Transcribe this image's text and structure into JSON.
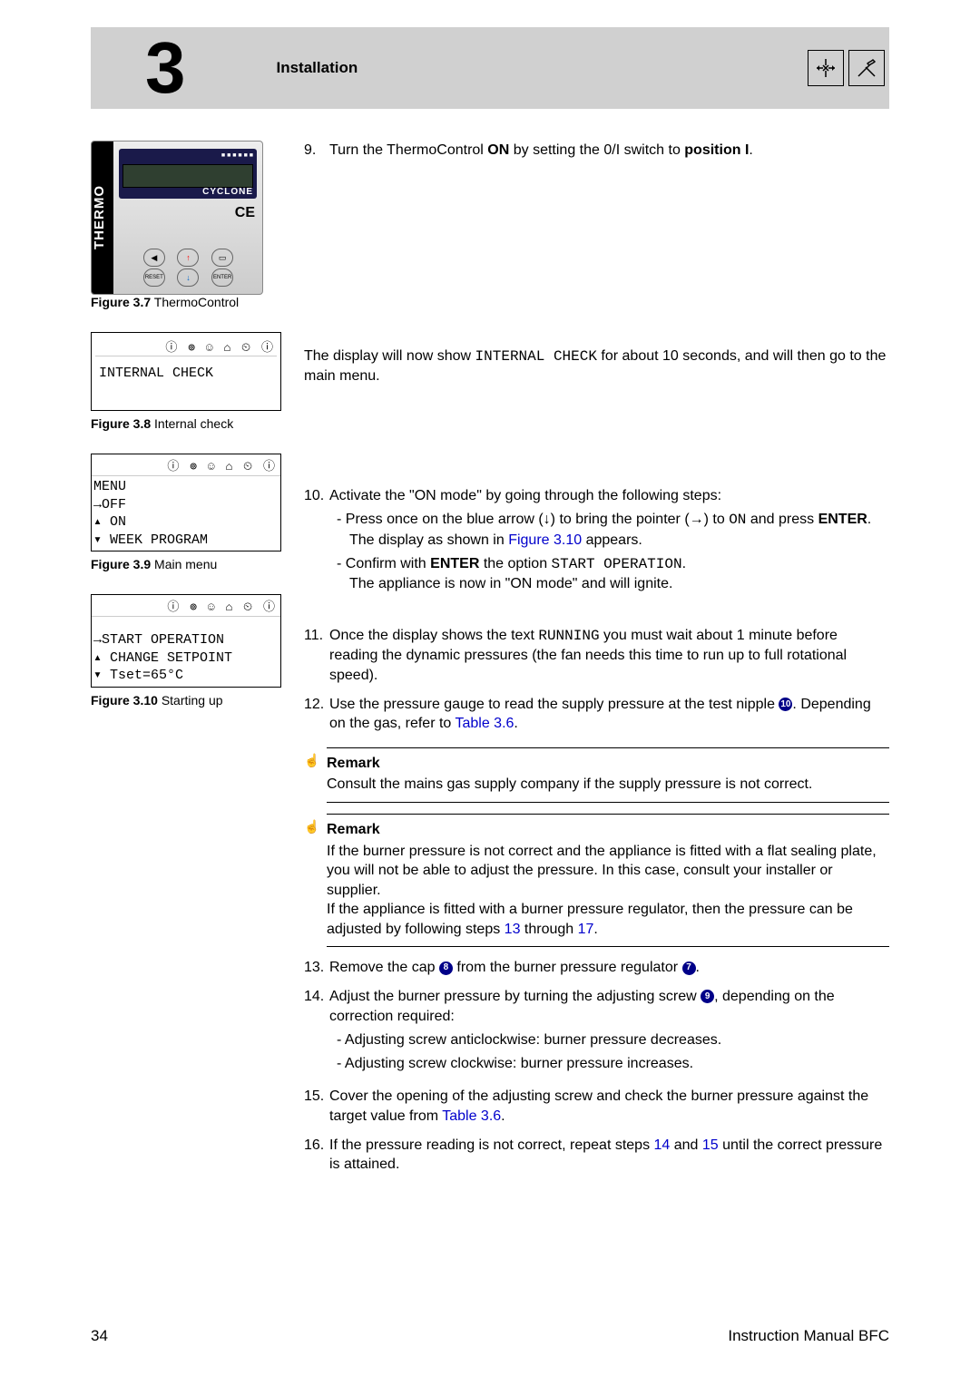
{
  "chapter": {
    "number": "3",
    "title": "Installation"
  },
  "figures": {
    "f37": {
      "label": "Figure 3.7",
      "caption": "ThermoControl"
    },
    "f38": {
      "label": "Figure 3.8",
      "caption": "Internal check",
      "icons": "ⓘ ⊚ ☺ ⌂ ⏲ ⓘ",
      "line1": "INTERNAL CHECK"
    },
    "f39": {
      "label": "Figure 3.9",
      "caption": "Main menu",
      "icons": "ⓘ ⊚ ☺ ⌂ ⏲ ⓘ",
      "l1": "MENU",
      "l2": " →OFF",
      "l3": "▴ ON",
      "l4": "▾ WEEK PROGRAM"
    },
    "f310": {
      "label": "Figure 3.10",
      "caption": "Starting up",
      "icons": "ⓘ ⊚ ☺ ⌂ ⏲ ⓘ",
      "l1": " →START OPERATION",
      "l2": "▴ CHANGE SETPOINT",
      "l3": "▾        Tset=65°C"
    }
  },
  "steps": {
    "s9": {
      "n": "9.",
      "t1": "Turn the ThermoControl ",
      "b1": "ON",
      "t2": " by setting the 0/I switch to ",
      "b2": "position I",
      "t3": "."
    },
    "intro": {
      "t1": "The display will now show ",
      "m1": "INTERNAL CHECK",
      "t2": " for about 10 seconds, and will then go to the main menu."
    },
    "s10": {
      "n": "10.",
      "t": "Activate the \"ON mode\" by going through the following steps:",
      "a": {
        "t1": "Press once on the blue arrow (",
        "arr": "↓",
        "t2": ") to bring the pointer (",
        "ptr": "→",
        "t3": ") to ",
        "m1": "ON",
        "t4": " and press ",
        "b1": "ENTER",
        "t5": ". The display as shown in ",
        "link": "Figure 3.10",
        "t6": " appears."
      },
      "b": {
        "t1": "Confirm with ",
        "b1": "ENTER",
        "t2": " the option ",
        "m1": "START OPERATION",
        "t3": "."
      },
      "c": "The appliance is now in \"ON mode\" and will ignite."
    },
    "s11": {
      "n": "11.",
      "t1": "Once the display shows the text ",
      "m1": "RUNNING",
      "t2": " you must wait about 1 minute before reading the dynamic pressures (the fan needs this time to run up to full rotational speed)."
    },
    "s12": {
      "n": "12.",
      "t1": "Use the pressure gauge to read the supply pressure at the test nipple ",
      "c1": "10",
      "t2": ". Depending on the gas, refer to ",
      "link": "Table 3.6",
      "t3": "."
    },
    "s13": {
      "n": "13.",
      "t1": "Remove the cap ",
      "c1": "8",
      "t2": " from the burner pressure regulator ",
      "c2": "7",
      "t3": "."
    },
    "s14": {
      "n": "14.",
      "t1": "Adjust the burner pressure by turning the adjusting screw ",
      "c1": "9",
      "t2": ", depending on the correction required:",
      "a": "Adjusting screw anticlockwise: burner pressure decreases.",
      "b": "Adjusting screw clockwise: burner pressure increases."
    },
    "s15": {
      "n": "15.",
      "t1": "Cover the opening of the adjusting screw and check the burner pressure against the target value from ",
      "link": "Table 3.6",
      "t2": "."
    },
    "s16": {
      "n": "16.",
      "t1": "If the pressure reading is not correct, repeat steps ",
      "l1": "14",
      "t2": " and ",
      "l2": "15",
      "t3": " until the correct pressure is attained."
    }
  },
  "remarks": {
    "r1": {
      "title": "Remark",
      "body": "Consult the mains gas supply company if the supply pressure is not correct."
    },
    "r2": {
      "title": "Remark",
      "b1": "If the burner pressure is not correct and the appliance is fitted with a flat sealing plate, you will not be able to adjust the pressure. In this case, consult your installer or supplier.",
      "b2a": "If the appliance is fitted with a burner pressure regulator, then the pressure can be adjusted by following steps ",
      "l1": "13",
      "b2b": " through ",
      "l2": "17",
      "b2c": "."
    }
  },
  "thermo": {
    "brand": "THERMO",
    "cyclone": "CYCLONE",
    "ce": "CE"
  },
  "footer": {
    "page": "34",
    "doc": "Instruction Manual BFC"
  }
}
